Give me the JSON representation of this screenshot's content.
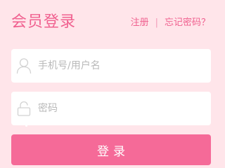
{
  "header": {
    "title": "会员登录",
    "register_label": "注册",
    "separator": "|",
    "forgot_label": "忘记密码？"
  },
  "form": {
    "username": {
      "placeholder": "手机号/用户名",
      "value": "",
      "icon": "user-icon"
    },
    "password": {
      "placeholder": "密码",
      "value": "",
      "icon": "lock-icon"
    },
    "submit_label": "登录"
  },
  "colors": {
    "background": "#ffe5ea",
    "accent": "#f0608f",
    "button": "#f56a98",
    "field_background": "#ffffff",
    "placeholder": "#b9b9b9"
  }
}
